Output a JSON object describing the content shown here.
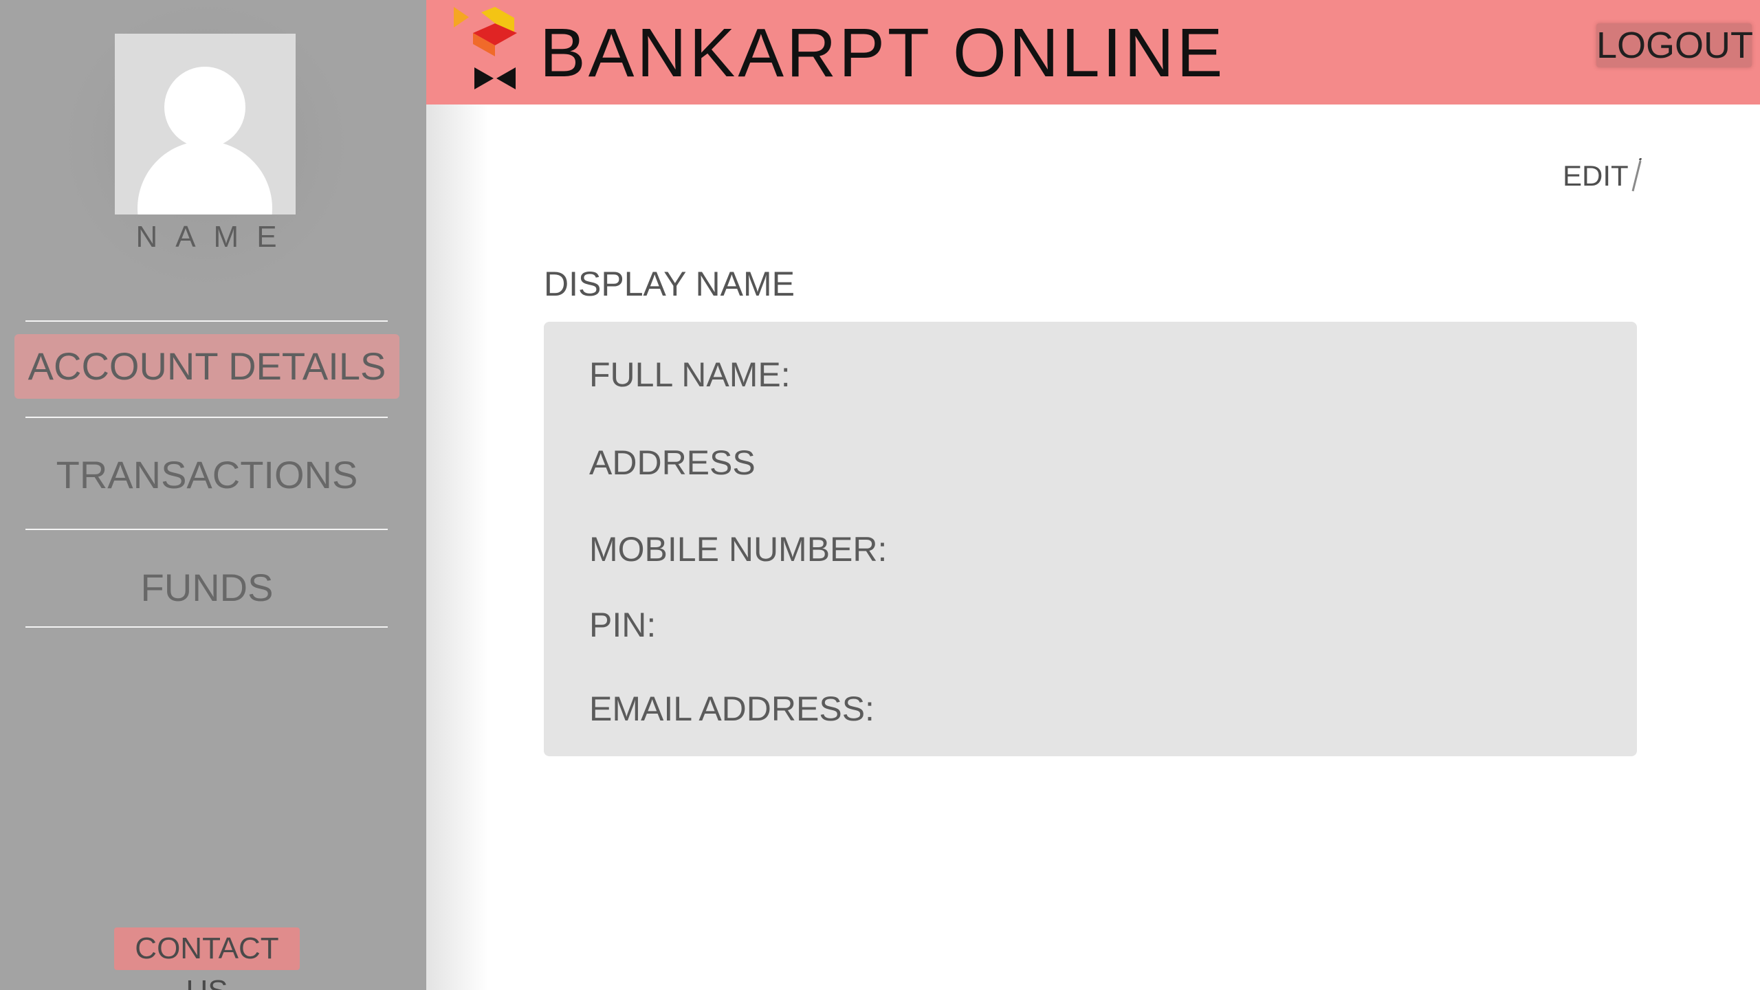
{
  "profile": {
    "name": "NAME"
  },
  "nav": {
    "items": [
      {
        "label": "ACCOUNT DETAILS",
        "active": true
      },
      {
        "label": "TRANSACTIONS",
        "active": false
      },
      {
        "label": "FUNDS",
        "active": false
      }
    ]
  },
  "sidebar": {
    "contact_label": "CONTACT US"
  },
  "header": {
    "title": "BANKARPT  ONLINE",
    "logout_label": "LOGOUT"
  },
  "main": {
    "edit_label": "EDIT",
    "section_title": "DISPLAY NAME",
    "fields": [
      {
        "label": "FULL NAME:"
      },
      {
        "label": "ADDRESS"
      },
      {
        "label": "MOBILE NUMBER:"
      },
      {
        "label": "PIN:"
      },
      {
        "label": "EMAIL ADDRESS:"
      }
    ]
  },
  "colors": {
    "header_bg": "#f48a8a",
    "sidebar_bg": "#a3a3a3",
    "active_nav_bg": "#d49a9a",
    "contact_bg": "#e08c8c",
    "panel_bg": "#e4e4e4"
  },
  "icons": {
    "logo": "bankarpt-logo-icon",
    "avatar": "user-silhouette-icon",
    "edit": "pencil-icon"
  }
}
